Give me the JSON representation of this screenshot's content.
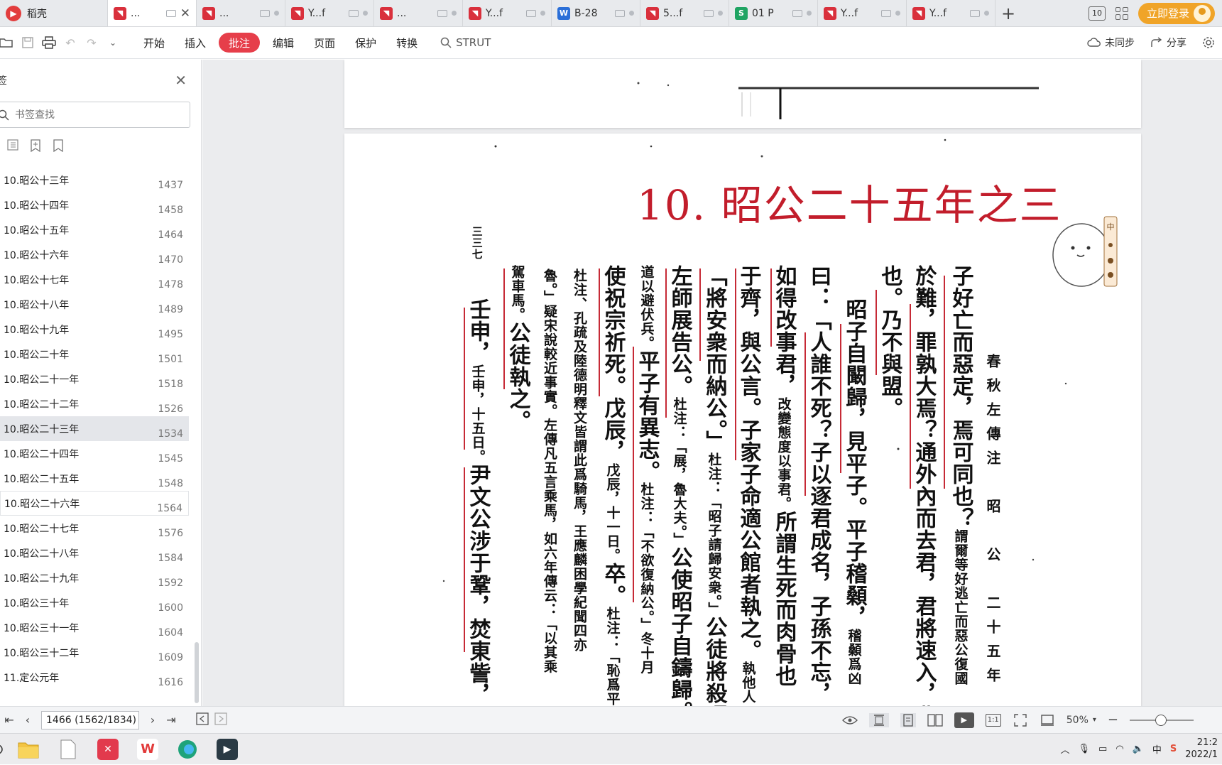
{
  "tabs": {
    "app_name": "稻壳",
    "items": [
      {
        "label": "...",
        "type": "pdf",
        "active": true
      },
      {
        "label": "...",
        "type": "pdf"
      },
      {
        "label": "Y...f",
        "type": "pdf"
      },
      {
        "label": "...",
        "type": "pdf"
      },
      {
        "label": "Y...f",
        "type": "pdf"
      },
      {
        "label": "B-28",
        "type": "word"
      },
      {
        "label": "5...f",
        "type": "pdf"
      },
      {
        "label": "01 P",
        "type": "sheet"
      },
      {
        "label": "Y...f",
        "type": "pdf"
      },
      {
        "label": "Y...f",
        "type": "pdf"
      }
    ],
    "window_count": "10",
    "login_label": "立即登录"
  },
  "toolbar": {
    "menu": [
      "开始",
      "插入",
      "批注",
      "编辑",
      "页面",
      "保护",
      "转换"
    ],
    "active_menu": "批注",
    "search_label": "STRUT",
    "sync_label": "未同步",
    "share_label": "分享"
  },
  "sidebar": {
    "title": "签",
    "search_placeholder": "书签查找",
    "bookmarks": [
      {
        "label": "10.昭公十三年",
        "page": "1437"
      },
      {
        "label": "10.昭公十四年",
        "page": "1458"
      },
      {
        "label": "10.昭公十五年",
        "page": "1464"
      },
      {
        "label": "10.昭公十六年",
        "page": "1470"
      },
      {
        "label": "10.昭公十七年",
        "page": "1478"
      },
      {
        "label": "10.昭公十八年",
        "page": "1489"
      },
      {
        "label": "10.昭公十九年",
        "page": "1495"
      },
      {
        "label": "10.昭公二十年",
        "page": "1501"
      },
      {
        "label": "10.昭公二十一年",
        "page": "1518"
      },
      {
        "label": "10.昭公二十二年",
        "page": "1526"
      },
      {
        "label": "10.昭公二十三年",
        "page": "1534"
      },
      {
        "label": "10.昭公二十四年",
        "page": "1545"
      },
      {
        "label": "10.昭公二十五年",
        "page": "1548"
      },
      {
        "label": "10.昭公二十六年",
        "page": "1564"
      },
      {
        "label": "10.昭公二十七年",
        "page": "1576"
      },
      {
        "label": "10.昭公二十八年",
        "page": "1584"
      },
      {
        "label": "10.昭公二十九年",
        "page": "1592"
      },
      {
        "label": "10.昭公三十年",
        "page": "1600"
      },
      {
        "label": "10.昭公三十一年",
        "page": "1604"
      },
      {
        "label": "10.昭公三十二年",
        "page": "1609"
      },
      {
        "label": "11.定公元年",
        "page": "1616"
      }
    ],
    "selected_index": 10,
    "hovered_index": 13
  },
  "document": {
    "chapter_title": "10. 昭公二十五年之三",
    "running_head": "春秋左傳注　昭　公　二十五年",
    "page_number_mark": "三三七",
    "columns": [
      {
        "text": "子好亡而惡定，焉可同也？",
        "note": "謂爾等好逃亡而惡公復國",
        "size": "big"
      },
      {
        "text": "於難，罪孰大焉？通外內而去君，君將速入，弗",
        "size": "big"
      },
      {
        "text": "也。乃不與盟。",
        "size": "big"
      },
      {
        "text": "昭子自闞歸，見平子。平子稽顙，",
        "note": "稽顙爲凶",
        "size": "big"
      },
      {
        "text": "曰：「人誰不死？子以逐君成名，子孫不忘，不",
        "size": "big"
      },
      {
        "text": "如得改事君，",
        "note": "改變態度以事君。",
        "text2": "所謂生死而肉骨也",
        "size": "big"
      },
      {
        "text": "于齊，與公言。子家子命適公館者執之。",
        "note": "執他人",
        "size": "big"
      },
      {
        "text": "「將安衆而納公。」",
        "note": "杜注：「昭子請歸安衆。」",
        "text2": "公徒將殺昭",
        "size": "big"
      },
      {
        "text": "左師展告公。",
        "note": "杜注：「展，魯大夫。」",
        "text2": "公使昭子自鑄歸。",
        "size": "big"
      },
      {
        "text": "道以避伏兵。",
        "size": "small",
        "text2": "平子有異志。",
        "note": "杜注：「不欲復納公。」冬十月"
      },
      {
        "text": "使祝宗祈死。戊辰，",
        "note": "戊辰，十一日。",
        "text2": "卒。",
        "note2": "杜注：「恥爲平"
      },
      {
        "text": "杜注、孔疏及陸德明釋文皆謂此爲騎馬，王應麟困學紀聞四亦",
        "size": "small"
      },
      {
        "text": "魯。」疑宋說較近事實。左傳凡五言乘馬，如六年傳云：「以其乘",
        "size": "small"
      },
      {
        "text": "壬申，",
        "note": "壬申，十五日。",
        "text2": "尹文公涉于鞏，焚東訾，",
        "size": "big"
      },
      {
        "text": "駕車馬。",
        "text2": "公徒執之。",
        "size": "small"
      }
    ]
  },
  "statusbar": {
    "page_display": "1466 (1562/1834)",
    "zoom": "50%"
  },
  "taskbar": {
    "time": "21:2",
    "date": "2022/1",
    "ime": "中"
  }
}
